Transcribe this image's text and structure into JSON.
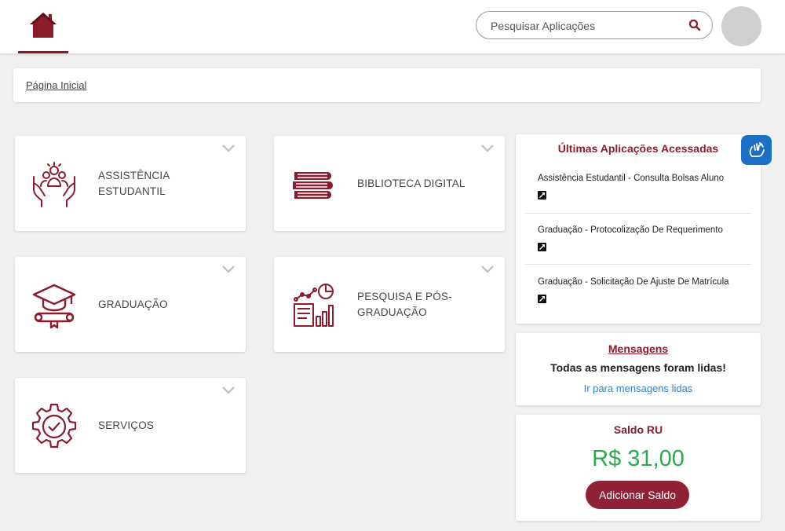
{
  "search": {
    "placeholder": "Pesquisar Aplicações"
  },
  "breadcrumb": {
    "label": "Página Inicial"
  },
  "apps": [
    {
      "label": "ASSISTÊNCIA ESTUDANTIL",
      "icon": "student-assistance-icon"
    },
    {
      "label": "BIBLIOTECA DIGITAL",
      "icon": "books-icon"
    },
    {
      "label": "GRADUAÇÃO",
      "icon": "graduation-cap-icon"
    },
    {
      "label": "PESQUISA E PÓS-GRADUAÇÃO",
      "icon": "research-chart-icon"
    },
    {
      "label": "SERVIÇOS",
      "icon": "services-gear-icon"
    }
  ],
  "recent": {
    "title": "Últimas Aplicações Acessadas",
    "items": [
      "Assistência Estudantil - Consulta Bolsas Aluno",
      "Graduação - Protocolização De Requerimento",
      "Graduação - Solicitação De Ajuste De Matrícula"
    ]
  },
  "messages": {
    "title": "Mensagens",
    "body": "Todas as mensagens foram lidas!",
    "link": "Ir para mensagens lidas"
  },
  "balance": {
    "title": "Saldo RU",
    "value": "R$ 31,00",
    "button": "Adicionar Saldo"
  },
  "colors": {
    "brand": "#8c1c2c",
    "money": "#2ea84e",
    "link": "#2f7fd1",
    "accessibility": "#1b6fc7"
  }
}
